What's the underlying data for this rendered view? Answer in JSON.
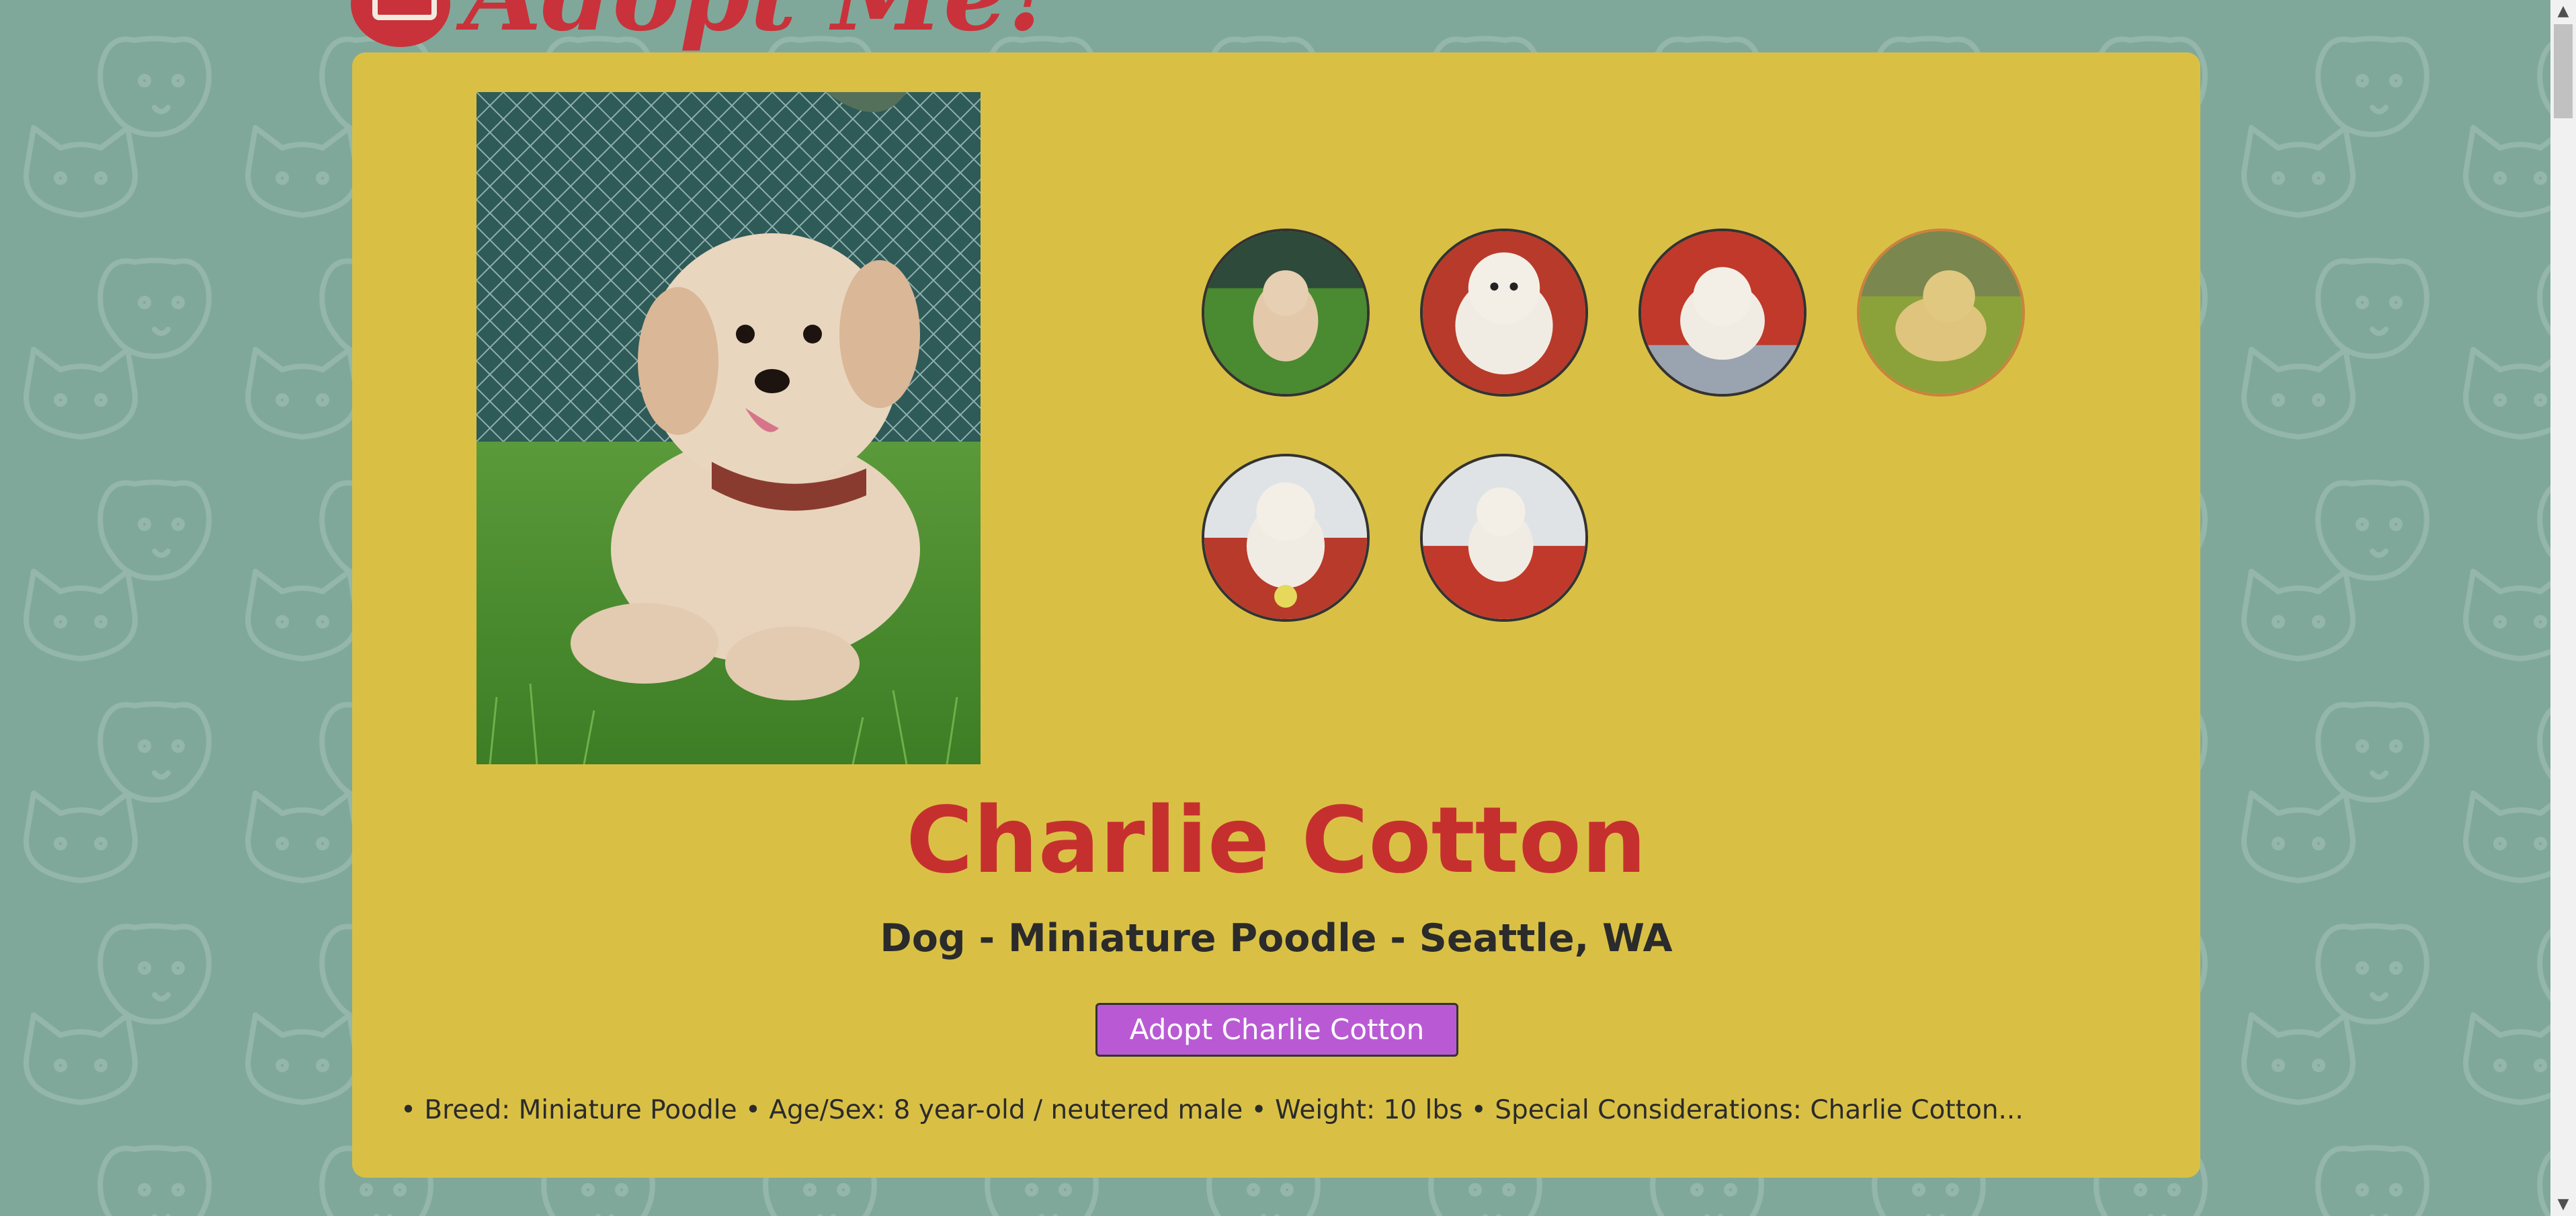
{
  "site": {
    "logo_text": "Adopt Me!",
    "colors": {
      "background": "#7fa89b",
      "card": "#d9c045",
      "accent_red": "#c5302f",
      "button": "#b95ad4"
    }
  },
  "pet": {
    "name": "Charlie Cotton",
    "subtitle": "Dog - Miniature Poodle - Seattle, WA",
    "adopt_label": "Adopt Charlie Cotton",
    "description": "• Breed: Miniature Poodle • Age/Sex: 8 year-old / neutered male • Weight: 10 lbs • Special Considerations: Charlie Cotton..."
  },
  "gallery": {
    "thumbnails": [
      {
        "name": "thumb-1",
        "scene": "grass"
      },
      {
        "name": "thumb-2",
        "scene": "red blanket"
      },
      {
        "name": "thumb-3",
        "scene": "red blanket"
      },
      {
        "name": "thumb-4",
        "scene": "grass",
        "active": true
      },
      {
        "name": "thumb-5",
        "scene": "red blanket with ball"
      },
      {
        "name": "thumb-6",
        "scene": "red blanket"
      }
    ]
  },
  "scrollbar": {
    "up_icon": "chevron-up-icon",
    "down_icon": "chevron-down-icon"
  }
}
